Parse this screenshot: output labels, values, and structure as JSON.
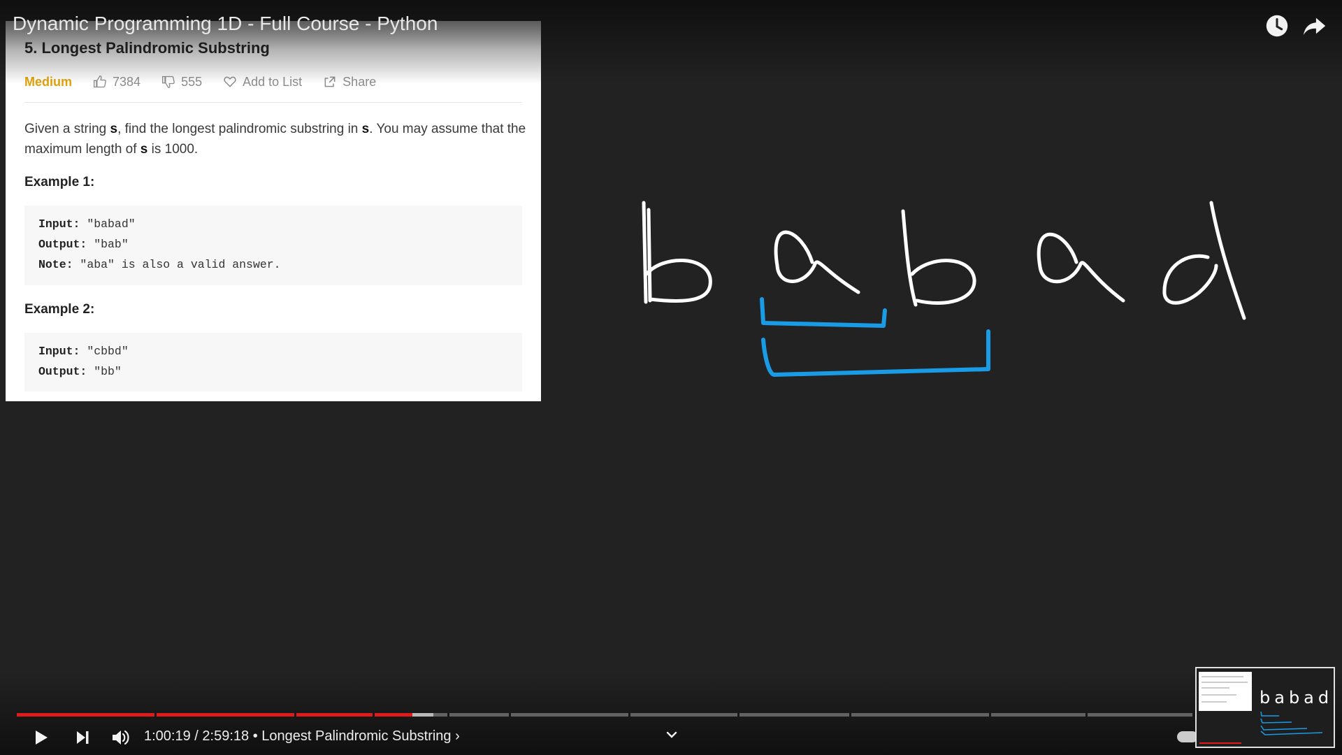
{
  "video": {
    "title": "Dynamic Programming 1D - Full Course - Python"
  },
  "top_actions": [
    {
      "name": "watch-later-icon"
    },
    {
      "name": "share-icon"
    }
  ],
  "problem": {
    "title": "5. Longest Palindromic Substring",
    "difficulty": "Medium",
    "difficulty_color": "#e3a008",
    "likes": "7384",
    "dislikes": "555",
    "add_to_list": "Add to List",
    "share": "Share",
    "description": {
      "p1": "Given a string ",
      "s1": "s",
      "p2": ", find the longest palindromic substring in ",
      "s2": "s",
      "p3": ". You may assume that the maximum length of ",
      "s3": "s",
      "p4": " is 1000."
    },
    "examples": [
      {
        "heading": "Example 1:",
        "lines": [
          {
            "key": "Input:",
            "value": " \"babad\""
          },
          {
            "key": "Output:",
            "value": " \"bab\""
          },
          {
            "key": "Note:",
            "value": " \"aba\" is also a valid answer."
          }
        ]
      },
      {
        "heading": "Example 2:",
        "lines": [
          {
            "key": "Input:",
            "value": " \"cbbd\""
          },
          {
            "key": "Output:",
            "value": " \"bb\""
          }
        ]
      }
    ]
  },
  "whiteboard": {
    "letters": [
      "b",
      "a",
      "b",
      "a",
      "d"
    ],
    "ink_color": "#ffffff",
    "bracket_color": "#1a9be6"
  },
  "player": {
    "current_time": "1:00:19",
    "separator": " / ",
    "duration": "2:59:18",
    "chapter_bullet": "•",
    "chapter": "Longest Palindromic Substring",
    "chapter_arrow": "›",
    "progress_played_fraction": 0.336,
    "accent_color": "#e01b1b"
  },
  "thumbnail": {
    "text": "babad"
  }
}
